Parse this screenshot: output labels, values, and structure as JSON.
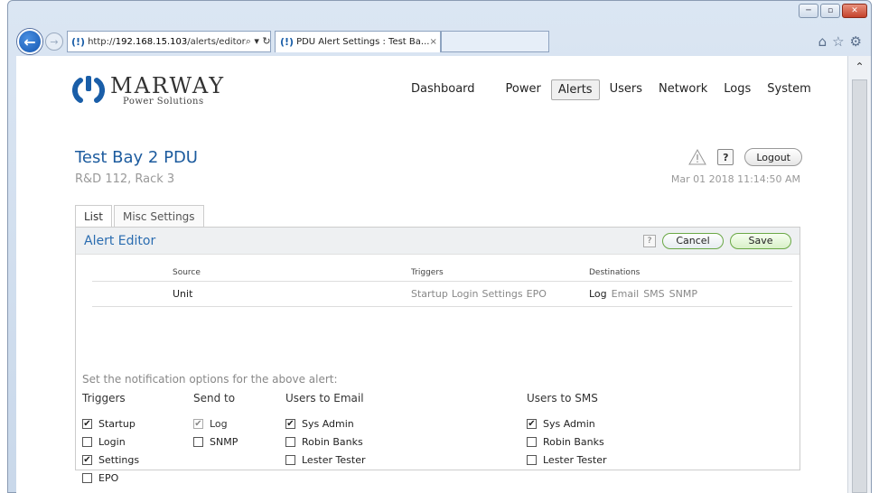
{
  "browser": {
    "url_prefix": "http://",
    "url_host": "192.168.15.103",
    "url_path": "/alerts/editor",
    "url_tools": "⌕ ▾ ↻",
    "tab_title": "PDU Alert Settings : Test Ba...",
    "tab_close": "×",
    "window_buttons": [
      "─",
      "▫",
      "✕"
    ],
    "nav_icons": [
      "⌂",
      "☆",
      "⚙"
    ]
  },
  "logo": {
    "title": "MARWAY",
    "subtitle": "Power Solutions"
  },
  "nav": {
    "items": [
      "Dashboard",
      "Power",
      "Alerts",
      "Users",
      "Network",
      "Logs",
      "System"
    ],
    "active": "Alerts"
  },
  "page": {
    "title": "Test Bay 2 PDU",
    "subtitle": "R&D 112, Rack 3",
    "help": "?",
    "logout": "Logout",
    "datetime": "Mar 01 2018 11:14:50 AM"
  },
  "tabs": [
    "List",
    "Misc Settings"
  ],
  "panel": {
    "title": "Alert Editor",
    "help": "?",
    "cancel": "Cancel",
    "save": "Save"
  },
  "table": {
    "headers": {
      "source": "Source",
      "triggers": "Triggers",
      "destinations": "Destinations"
    },
    "row": {
      "source": "Unit",
      "triggers": [
        "Startup",
        "Login",
        "Settings",
        "EPO"
      ],
      "destinations": [
        {
          "label": "Log",
          "active": true
        },
        {
          "label": "Email",
          "active": false
        },
        {
          "label": "SMS",
          "active": false
        },
        {
          "label": "SNMP",
          "active": false
        }
      ]
    }
  },
  "options": {
    "intro": "Set the notification options for the above alert:",
    "triggers": {
      "heading": "Triggers",
      "items": [
        {
          "label": "Startup",
          "checked": true
        },
        {
          "label": "Login",
          "checked": false
        },
        {
          "label": "Settings",
          "checked": true
        },
        {
          "label": "EPO",
          "checked": false
        }
      ]
    },
    "send_to": {
      "heading": "Send to",
      "items": [
        {
          "label": "Log",
          "checked": true,
          "disabled": true
        },
        {
          "label": "SNMP",
          "checked": false
        }
      ]
    },
    "users_email": {
      "heading": "Users to Email",
      "items": [
        {
          "label": "Sys Admin",
          "checked": true
        },
        {
          "label": "Robin Banks",
          "checked": false
        },
        {
          "label": "Lester Tester",
          "checked": false
        }
      ]
    },
    "users_sms": {
      "heading": "Users to SMS",
      "items": [
        {
          "label": "Sys Admin",
          "checked": true
        },
        {
          "label": "Robin Banks",
          "checked": false
        },
        {
          "label": "Lester Tester",
          "checked": false
        }
      ]
    }
  },
  "colors": {
    "accent": "#1c5b9e",
    "save_border": "#6aa846",
    "logo_blue": "#1a5ea8"
  }
}
